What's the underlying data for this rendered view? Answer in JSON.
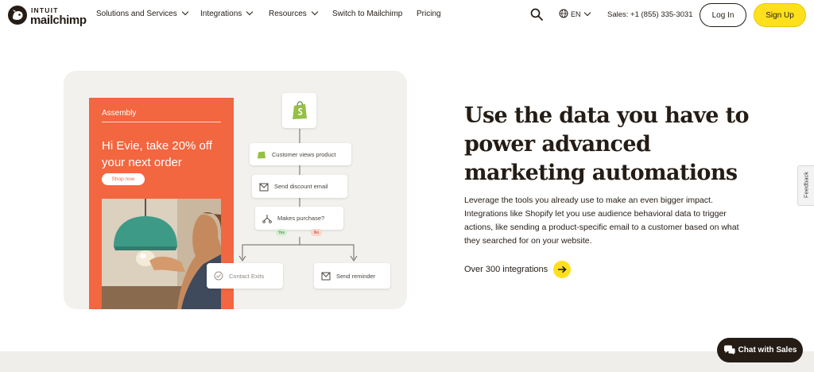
{
  "nav": {
    "logo_top": "INTUIT",
    "logo_bottom": "mailchimp",
    "items": [
      {
        "label": "Solutions and Services",
        "dropdown": true
      },
      {
        "label": "Integrations",
        "dropdown": true
      },
      {
        "label": "Resources",
        "dropdown": true
      },
      {
        "label": "Switch to Mailchimp",
        "dropdown": false
      },
      {
        "label": "Pricing",
        "dropdown": false
      }
    ],
    "search_icon": "search-icon",
    "language": "EN",
    "sales": "Sales: +1 (855) 335-3031",
    "login": "Log In",
    "signup": "Sign Up"
  },
  "promo": {
    "brand": "Assembly",
    "headline": "Hi Evie, take 20% off your next order",
    "button": "Shop now"
  },
  "flow": {
    "step1": "Customer views product",
    "step2": "Send discount email",
    "decision": "Makes purchase?",
    "yes": "Yes",
    "no": "No",
    "branch_yes": "Contact Exits",
    "branch_no": "Send reminder"
  },
  "content": {
    "heading": "Use the data you have to power advanced marketing automations",
    "body": "Leverage the tools you already use to make an even bigger impact. Integrations like Shopify let you use audience behavioral data to trigger actions, like sending a product-specific email to a customer based on what they searched for on your website.",
    "cta": "Over 300 integrations"
  },
  "feedback": "Feedback",
  "chat": "Chat with Sales",
  "colors": {
    "accent_yellow": "#ffe01b",
    "promo_orange": "#f26640",
    "ink": "#241c15",
    "shopify_green": "#95bf47"
  }
}
